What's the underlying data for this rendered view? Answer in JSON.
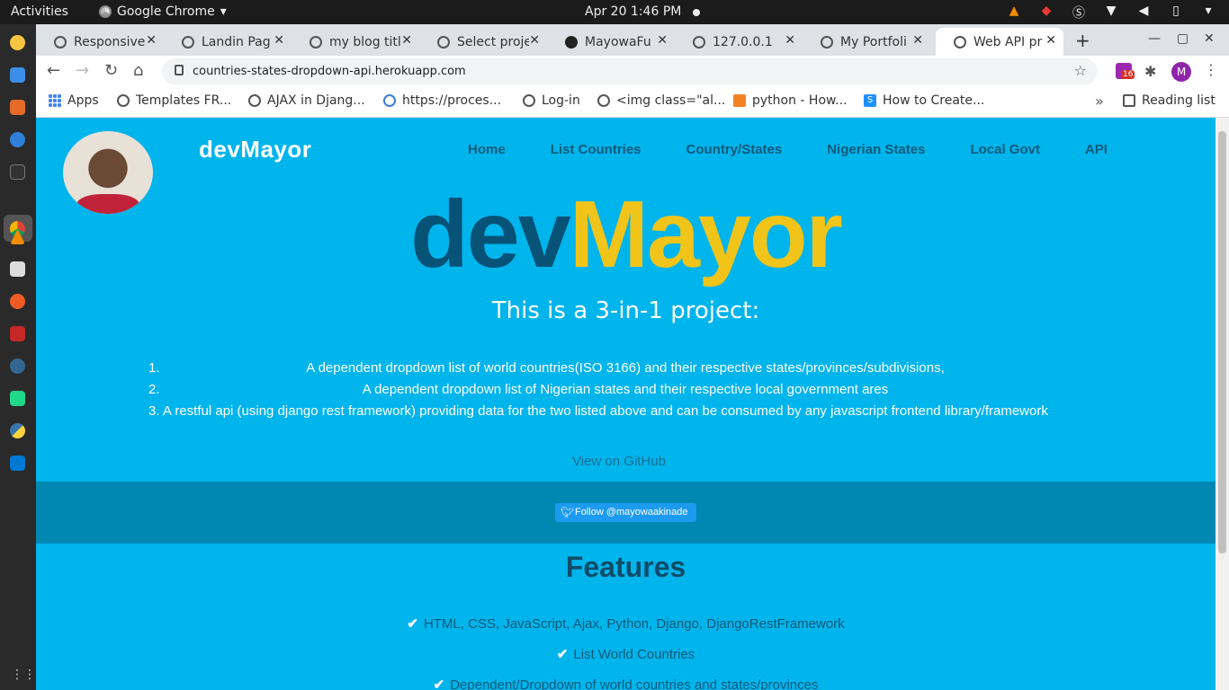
{
  "os": {
    "activities": "Activities",
    "app_name": "Google Chrome",
    "app_menu_arrow": "▾",
    "clock": "Apr 20  1:46 PM"
  },
  "tabs": [
    {
      "title": "Responsive",
      "active": false
    },
    {
      "title": "Landin Pag",
      "active": false
    },
    {
      "title": "my blog titl",
      "active": false
    },
    {
      "title": "Select proje",
      "active": false
    },
    {
      "title": "MayowaFu",
      "active": false
    },
    {
      "title": "127.0.0.1",
      "active": false
    },
    {
      "title": "My Portfoli",
      "active": false
    },
    {
      "title": "Web API pr",
      "active": true
    }
  ],
  "address": {
    "url": "countries-states-dropdown-api.herokuapp.com"
  },
  "extension_badge": "16",
  "profile_initial": "M",
  "bookmarks": [
    {
      "label": "Apps"
    },
    {
      "label": "Templates FR..."
    },
    {
      "label": "AJAX in Djang..."
    },
    {
      "label": "https://proces..."
    },
    {
      "label": "Log-in"
    },
    {
      "label": "<img class=\"al..."
    },
    {
      "label": "python - How..."
    },
    {
      "label": "How to Create..."
    }
  ],
  "reading_list": "Reading list",
  "site": {
    "brand": "devMayor",
    "nav": [
      "Home",
      "List Countries",
      "Country/States",
      "Nigerian States",
      "Local Govt",
      "API"
    ],
    "hero_a": "dev",
    "hero_b": "Mayor",
    "subtitle": "This is a 3-in-1 project:",
    "list": [
      {
        "num": "1.",
        "text": "A dependent dropdown list of world countries(ISO 3166) and their respective states/provinces/subdivisions,"
      },
      {
        "num": "2.",
        "text": "A dependent dropdown list of Nigerian states and their respective local government ares"
      },
      {
        "num": "3.",
        "text": "A restful api (using django rest framework) providing data for the two listed above and can be consumed by any javascript frontend library/framework"
      }
    ],
    "github_link": "View on GitHub",
    "twitter_button": "Follow @mayowaakinade",
    "features_title": "Features",
    "features": [
      "HTML, CSS, JavaScript, Ajax, Python, Django, DjangoRestFramework",
      "List World Countries",
      "Dependent/Dropdown of world countries and states/provinces"
    ]
  },
  "colors": {
    "page_bg": "#00b4ec",
    "hero_dark": "#065377",
    "hero_yellow": "#f0c419",
    "band": "#0088b3",
    "twitter": "#1d9bf0"
  }
}
